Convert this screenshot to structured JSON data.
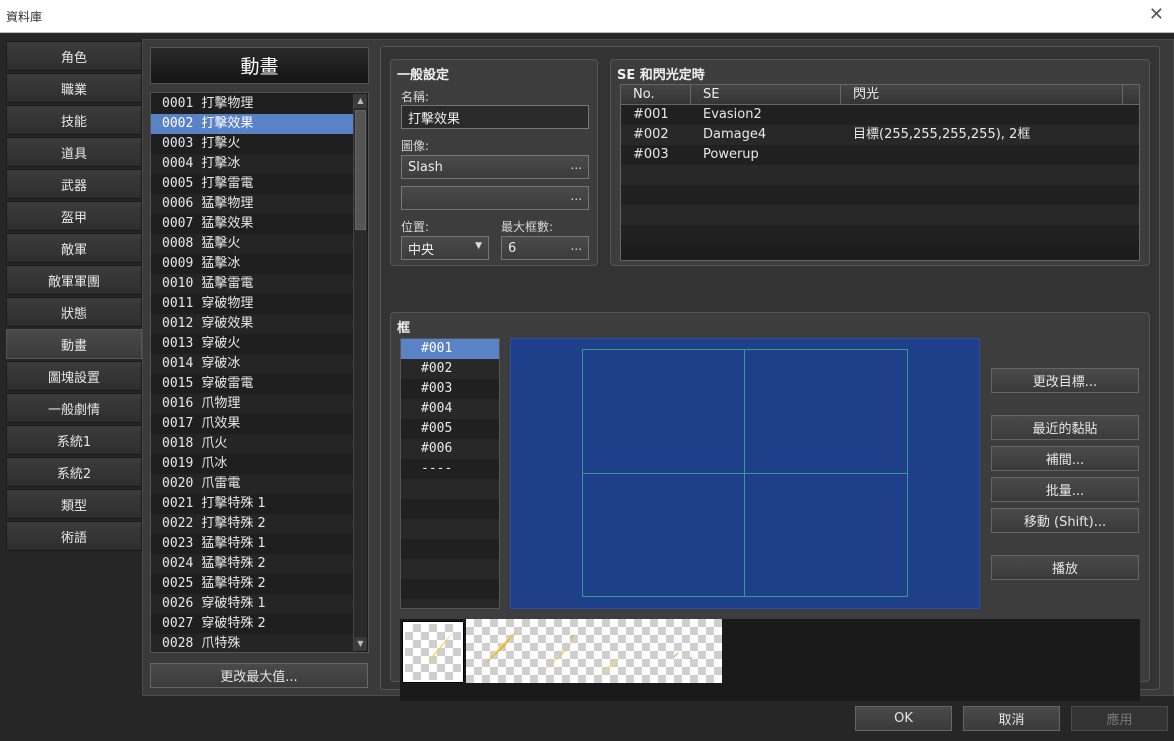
{
  "window": {
    "title": "資料庫"
  },
  "nav": {
    "items": [
      "角色",
      "職業",
      "技能",
      "道具",
      "武器",
      "盔甲",
      "敵軍",
      "敵軍軍團",
      "狀態",
      "動畫",
      "圖塊設置",
      "一般劇情",
      "系統1",
      "系統2",
      "類型",
      "術語"
    ],
    "active_index": 9
  },
  "list": {
    "header": "動畫",
    "selected_index": 1,
    "items": [
      {
        "num": "0001",
        "name": "打擊物理"
      },
      {
        "num": "0002",
        "name": "打擊效果"
      },
      {
        "num": "0003",
        "name": "打擊火"
      },
      {
        "num": "0004",
        "name": "打擊冰"
      },
      {
        "num": "0005",
        "name": "打擊雷電"
      },
      {
        "num": "0006",
        "name": "猛擊物理"
      },
      {
        "num": "0007",
        "name": "猛擊效果"
      },
      {
        "num": "0008",
        "name": "猛擊火"
      },
      {
        "num": "0009",
        "name": "猛擊冰"
      },
      {
        "num": "0010",
        "name": "猛擊雷電"
      },
      {
        "num": "0011",
        "name": "穿破物理"
      },
      {
        "num": "0012",
        "name": "穿破效果"
      },
      {
        "num": "0013",
        "name": "穿破火"
      },
      {
        "num": "0014",
        "name": "穿破冰"
      },
      {
        "num": "0015",
        "name": "穿破雷電"
      },
      {
        "num": "0016",
        "name": "爪物理"
      },
      {
        "num": "0017",
        "name": "爪效果"
      },
      {
        "num": "0018",
        "name": "爪火"
      },
      {
        "num": "0019",
        "name": "爪冰"
      },
      {
        "num": "0020",
        "name": "爪雷電"
      },
      {
        "num": "0021",
        "name": "打擊特殊 1"
      },
      {
        "num": "0022",
        "name": "打擊特殊 2"
      },
      {
        "num": "0023",
        "name": "猛擊特殊 1"
      },
      {
        "num": "0024",
        "name": "猛擊特殊 2"
      },
      {
        "num": "0025",
        "name": "猛擊特殊 2"
      },
      {
        "num": "0026",
        "name": "穿破特殊 1"
      },
      {
        "num": "0027",
        "name": "穿破特殊 2"
      },
      {
        "num": "0028",
        "name": "爪特殊"
      }
    ],
    "change_max_label": "更改最大值..."
  },
  "general": {
    "title": "一般設定",
    "name_label": "名稱:",
    "name_value": "打擊效果",
    "image_label": "圖像:",
    "image1_value": "Slash",
    "image2_value": "",
    "position_label": "位置:",
    "position_value": "中央",
    "max_frames_label": "最大框數:",
    "max_frames_value": "6",
    "dots": "..."
  },
  "se": {
    "title": "SE 和閃光定時",
    "columns": [
      "No.",
      "SE",
      "閃光"
    ],
    "rows": [
      {
        "no": "#001",
        "se": "Evasion2",
        "flash": ""
      },
      {
        "no": "#002",
        "se": "Damage4",
        "flash": "目標(255,255,255,255), 2框"
      },
      {
        "no": "#003",
        "se": "Powerup",
        "flash": ""
      }
    ]
  },
  "frames": {
    "title": "框",
    "selected_index": 0,
    "items": [
      "#001",
      "#002",
      "#003",
      "#004",
      "#005",
      "#006",
      "----"
    ],
    "buttons": {
      "change_target": "更改目標...",
      "recent_paste": "最近的黏貼",
      "tween": "補間...",
      "batch": "批量...",
      "shift": "移動 (Shift)...",
      "play": "播放"
    }
  },
  "footer": {
    "ok": "OK",
    "cancel": "取消",
    "apply": "應用"
  },
  "colors": {
    "selection": "#5a82c7",
    "canvas": "#1f3f8a",
    "guide": "#2aa38a"
  }
}
